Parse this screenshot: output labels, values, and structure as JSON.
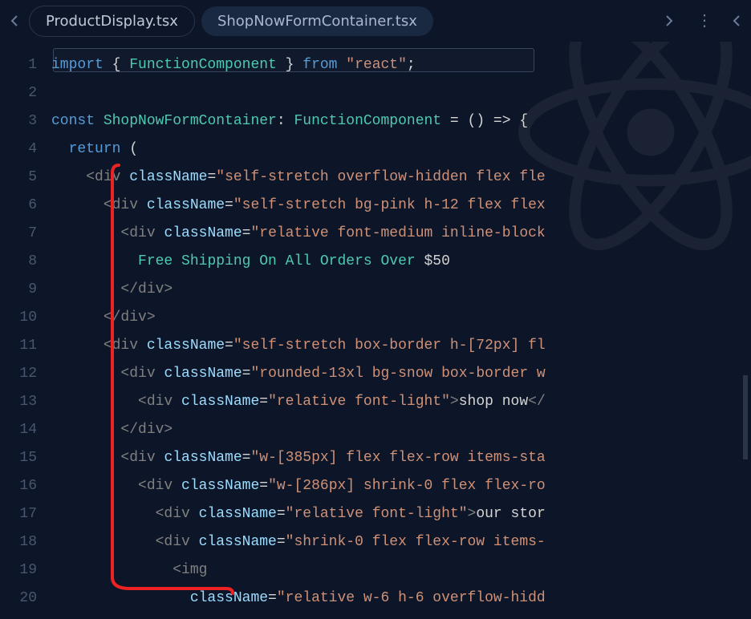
{
  "tabs": {
    "inactive": "ProductDisplay.tsx",
    "active": "ShopNowFormContainer.tsx"
  },
  "lineNumbers": [
    "1",
    "2",
    "3",
    "4",
    "5",
    "6",
    "7",
    "8",
    "9",
    "10",
    "11",
    "12",
    "13",
    "14",
    "15",
    "16",
    "17",
    "18",
    "19",
    "20"
  ],
  "code": {
    "l1": {
      "import": "import",
      "brace1": " { ",
      "comp": "FunctionComponent",
      "brace2": " } ",
      "from": "from",
      "sp": " ",
      "str": "\"react\"",
      "semi": ";"
    },
    "l3": {
      "const": "const",
      "name": " ShopNowFormContainer",
      "colon": ": ",
      "type": "FunctionComponent",
      "rest": " = () => {"
    },
    "l4": {
      "indent": "  ",
      "return": "return",
      "paren": " ("
    },
    "l5": {
      "indent": "    ",
      "open": "<div ",
      "attr": "className",
      "eq": "=",
      "val": "\"self-stretch overflow-hidden flex fle"
    },
    "l6": {
      "indent": "      ",
      "open": "<div ",
      "attr": "className",
      "eq": "=",
      "val": "\"self-stretch bg-pink h-12 flex flex"
    },
    "l7": {
      "indent": "        ",
      "open": "<div ",
      "attr": "className",
      "eq": "=",
      "val": "\"relative font-medium inline-block"
    },
    "l8": {
      "indent": "          ",
      "text": "Free Shipping On All Orders Over ",
      "price": "$50"
    },
    "l9": {
      "indent": "        ",
      "close": "</div>"
    },
    "l10": {
      "indent": "      ",
      "close": "</div>"
    },
    "l11": {
      "indent": "      ",
      "open": "<div ",
      "attr": "className",
      "eq": "=",
      "val": "\"self-stretch box-border h-[72px] fl"
    },
    "l12": {
      "indent": "        ",
      "open": "<div ",
      "attr": "className",
      "eq": "=",
      "val": "\"rounded-13xl bg-snow box-border w"
    },
    "l13": {
      "indent": "          ",
      "open": "<div ",
      "attr": "className",
      "eq": "=",
      "val": "\"relative font-light\"",
      "gt": ">",
      "text": "shop now",
      "close": "</"
    },
    "l14": {
      "indent": "        ",
      "close": "</div>"
    },
    "l15": {
      "indent": "        ",
      "open": "<div ",
      "attr": "className",
      "eq": "=",
      "val": "\"w-[385px] flex flex-row items-sta"
    },
    "l16": {
      "indent": "          ",
      "open": "<div ",
      "attr": "className",
      "eq": "=",
      "val": "\"w-[286px] shrink-0 flex flex-ro"
    },
    "l17": {
      "indent": "            ",
      "open": "<div ",
      "attr": "className",
      "eq": "=",
      "val": "\"relative font-light\"",
      "gt": ">",
      "text": "our stor"
    },
    "l18": {
      "indent": "            ",
      "open": "<div ",
      "attr": "className",
      "eq": "=",
      "val": "\"shrink-0 flex flex-row items-"
    },
    "l19": {
      "indent": "              ",
      "open": "<img"
    },
    "l20": {
      "indent": "                ",
      "attr": "className",
      "eq": "=",
      "val": "\"relative w-6 h-6 overflow-hidd"
    }
  }
}
